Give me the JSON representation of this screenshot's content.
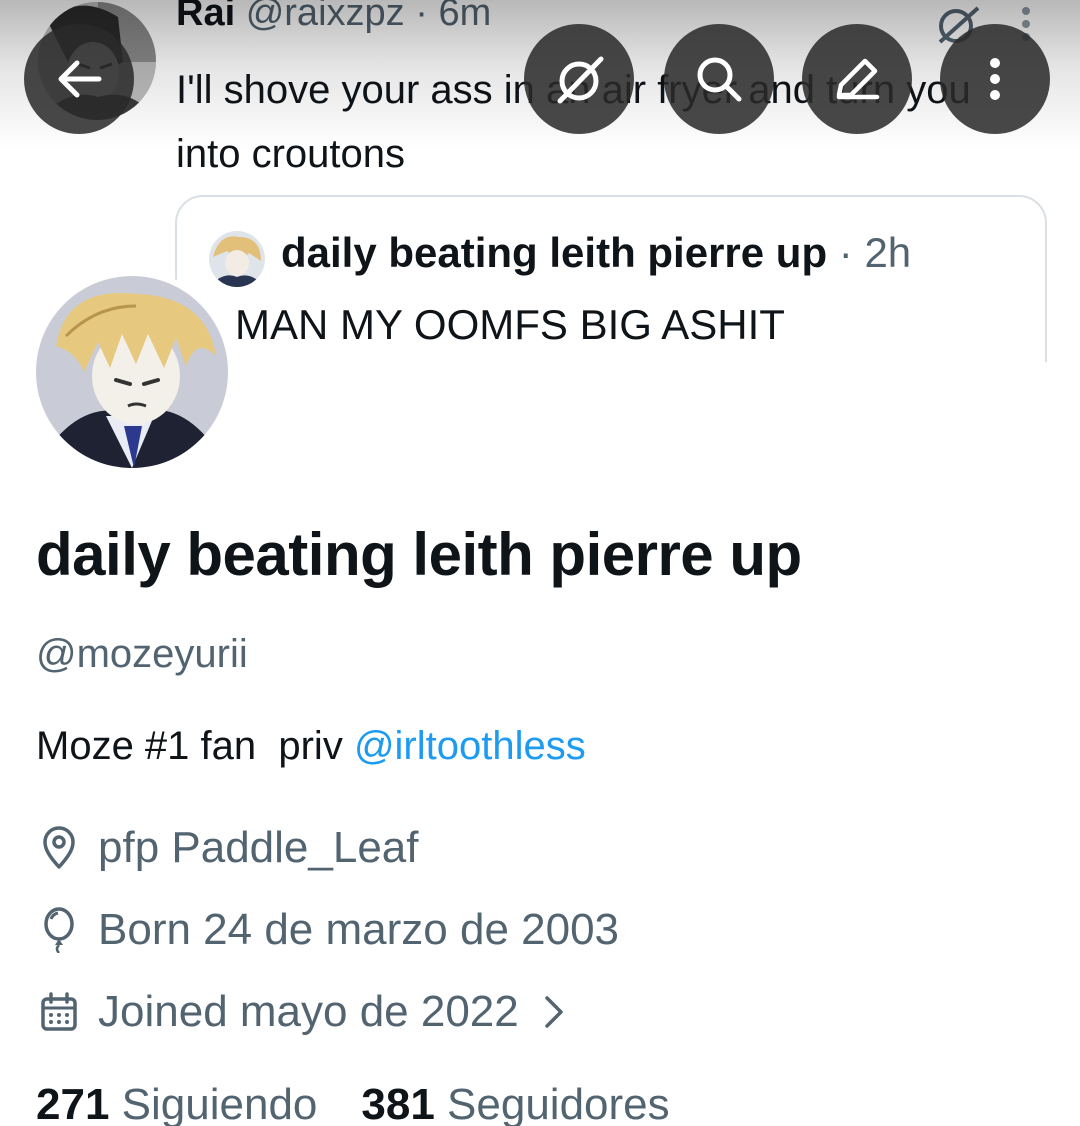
{
  "banner": {
    "tweet": {
      "author_name": "Rai",
      "author_handle": "@raixzpz",
      "separator": "·",
      "time": "6m",
      "text": "I'll shove your ass in an air fryer and turn you into croutons",
      "quote": {
        "author_name": "daily beating leith pierre up",
        "separator": "·",
        "time": "2h",
        "text": "MAN MY OOMFS BIG ASHIT"
      }
    }
  },
  "actions": {
    "back": "back-icon",
    "hide": "ghost-icon",
    "search": "search-icon",
    "edit": "edit-icon",
    "more": "more-icon"
  },
  "profile": {
    "display_name": "daily beating leith pierre up",
    "handle": "@mozeyurii",
    "bio_text": "Moze #1 fan  priv ",
    "bio_link": "@irltoothless",
    "location": "pfp Paddle_Leaf",
    "birthday": "Born 24 de marzo de 2003",
    "joined": "Joined mayo de 2022",
    "following_count": "271",
    "following_label": "Siguiendo",
    "followers_count": "381",
    "followers_label": "Seguidores"
  },
  "colors": {
    "text": "#0f1419",
    "secondary": "#536471",
    "link": "#1d9bf0",
    "fab": "#2a2a2a"
  }
}
